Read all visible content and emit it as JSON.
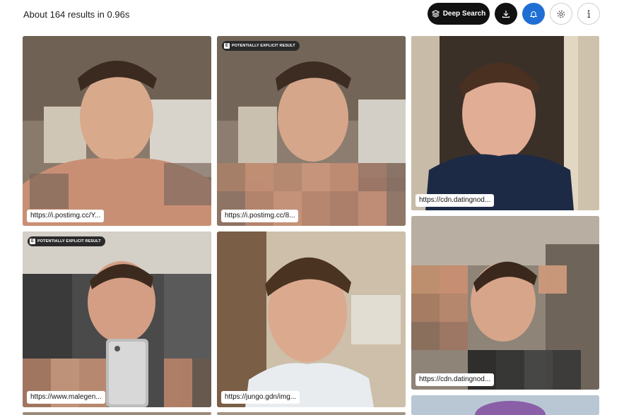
{
  "header": {
    "results_text": "About 164 results in 0.96s"
  },
  "toolbar": {
    "deep_search_label": "Deep Search",
    "icons": [
      "layers-icon",
      "download-icon",
      "bell-icon",
      "gear-icon",
      "info-icon"
    ],
    "colors": {
      "dark": "#111111",
      "accent": "#1f6ed4"
    }
  },
  "results": [
    {
      "url": "https://i.postimg.cc/Y...",
      "badge": ""
    },
    {
      "url": "https://i.postimg.cc/8...",
      "badge": "POTENTIALLY EXPLICIT RESULT"
    },
    {
      "url": "https://cdn.datingnod...",
      "badge": ""
    },
    {
      "url": "https://www.malegen...",
      "badge": "POTENTIALLY EXPLICIT RESULT"
    },
    {
      "url": "https://jungo.gdn/img...",
      "badge": ""
    },
    {
      "url": "https://cdn.datingnod...",
      "badge": ""
    }
  ],
  "badge_icon_letter": "E"
}
